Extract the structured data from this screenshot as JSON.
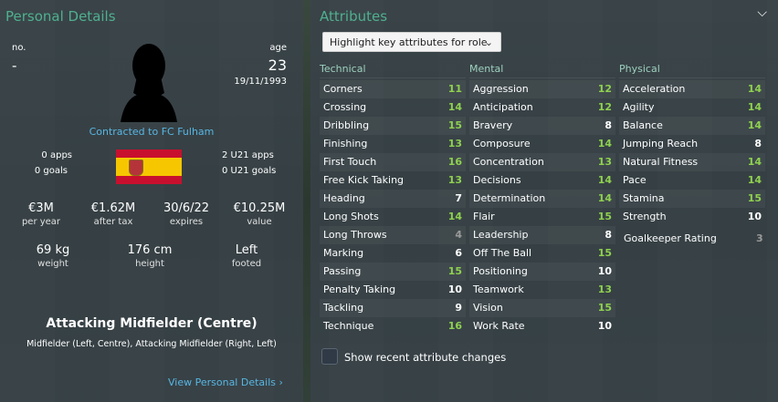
{
  "personal": {
    "title": "Personal Details",
    "no_label": "no.",
    "no_value": "-",
    "age_label": "age",
    "age_value": "23",
    "dob": "19/11/1993",
    "contract": "Contracted to FC Fulham",
    "apps": "0 apps",
    "goals": "0 goals",
    "u21_apps": "2 U21 apps",
    "u21_goals": "0 U21 goals",
    "nationality_flag": "spain-flag",
    "wage": {
      "value": "€3M",
      "label": "per year"
    },
    "after_tax": {
      "value": "€1.62M",
      "label": "after tax"
    },
    "expires": {
      "value": "30/6/22",
      "label": "expires"
    },
    "player_value": {
      "value": "€10.25M",
      "label": "value"
    },
    "weight": {
      "value": "69 kg",
      "label": "weight"
    },
    "height": {
      "value": "176 cm",
      "label": "height"
    },
    "foot": {
      "value": "Left",
      "label": "footed"
    },
    "position": "Attacking Midfielder (Centre)",
    "other_positions": "Midfielder (Left, Centre), Attacking Midfielder (Right, Left)",
    "view_link": "View Personal Details"
  },
  "attributes": {
    "title": "Attributes",
    "dropdown": "Highlight key attributes for role",
    "technical_header": "Technical",
    "mental_header": "Mental",
    "physical_header": "Physical",
    "technical": [
      {
        "name": "Corners",
        "value": "11"
      },
      {
        "name": "Crossing",
        "value": "14"
      },
      {
        "name": "Dribbling",
        "value": "15"
      },
      {
        "name": "Finishing",
        "value": "13"
      },
      {
        "name": "First Touch",
        "value": "16"
      },
      {
        "name": "Free Kick Taking",
        "value": "13"
      },
      {
        "name": "Heading",
        "value": "7"
      },
      {
        "name": "Long Shots",
        "value": "14"
      },
      {
        "name": "Long Throws",
        "value": "4"
      },
      {
        "name": "Marking",
        "value": "6"
      },
      {
        "name": "Passing",
        "value": "15"
      },
      {
        "name": "Penalty Taking",
        "value": "10"
      },
      {
        "name": "Tackling",
        "value": "9"
      },
      {
        "name": "Technique",
        "value": "16"
      }
    ],
    "mental": [
      {
        "name": "Aggression",
        "value": "12"
      },
      {
        "name": "Anticipation",
        "value": "12"
      },
      {
        "name": "Bravery",
        "value": "8"
      },
      {
        "name": "Composure",
        "value": "14"
      },
      {
        "name": "Concentration",
        "value": "13"
      },
      {
        "name": "Decisions",
        "value": "14"
      },
      {
        "name": "Determination",
        "value": "14"
      },
      {
        "name": "Flair",
        "value": "15"
      },
      {
        "name": "Leadership",
        "value": "8"
      },
      {
        "name": "Off The Ball",
        "value": "15"
      },
      {
        "name": "Positioning",
        "value": "10"
      },
      {
        "name": "Teamwork",
        "value": "13"
      },
      {
        "name": "Vision",
        "value": "15"
      },
      {
        "name": "Work Rate",
        "value": "10"
      }
    ],
    "physical": [
      {
        "name": "Acceleration",
        "value": "14"
      },
      {
        "name": "Agility",
        "value": "14"
      },
      {
        "name": "Balance",
        "value": "14"
      },
      {
        "name": "Jumping Reach",
        "value": "8"
      },
      {
        "name": "Natural Fitness",
        "value": "14"
      },
      {
        "name": "Pace",
        "value": "14"
      },
      {
        "name": "Stamina",
        "value": "15"
      },
      {
        "name": "Strength",
        "value": "10"
      }
    ],
    "goalkeeper_rating_label": "Goalkeeper Rating",
    "goalkeeper_rating_value": "3",
    "show_changes_label": "Show recent attribute changes",
    "collapse_icon": "chevron-down-icon"
  },
  "colors": {
    "title": "#4fb08e",
    "link": "#58b6e2",
    "high_value": "#8fd14f",
    "low_value": "#9a9a9a"
  }
}
